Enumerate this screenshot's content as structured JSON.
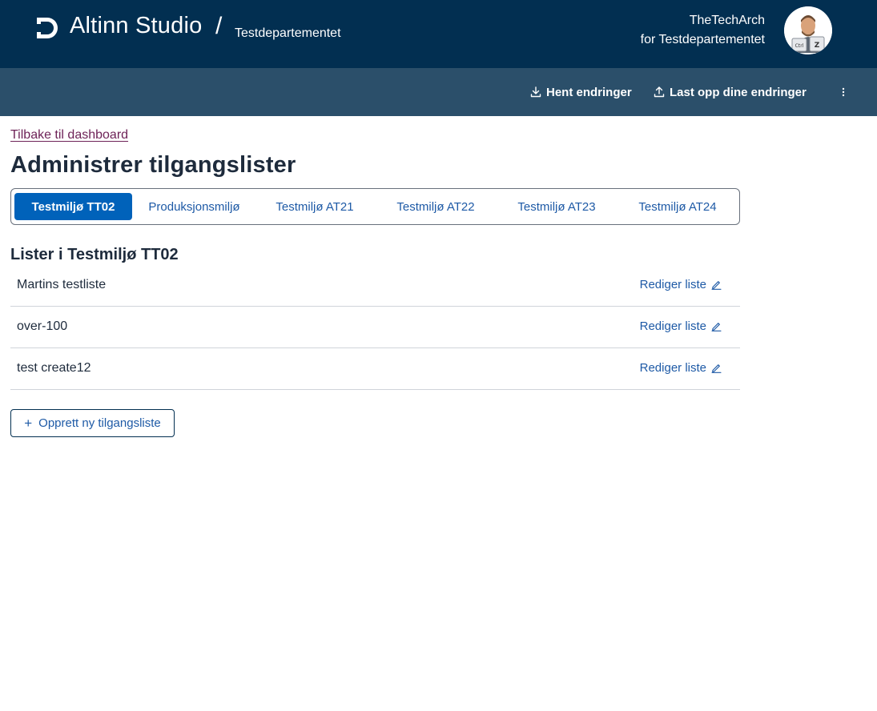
{
  "header": {
    "app_name": "Altinn Studio",
    "separator": "/",
    "org_name": "Testdepartementet",
    "user_name": "TheTechArch",
    "user_org": "for Testdepartementet",
    "logo_icon": "altinn-logo-icon",
    "avatar_icon": "user-avatar-icon",
    "background_color": "#022f51"
  },
  "subheader": {
    "fetch_label": "Hent endringer",
    "upload_label": "Last opp dine endringer",
    "more_icon": "kebab-menu-icon",
    "background_color": "#2b4f6a"
  },
  "back_link": "Tilbake til dashboard",
  "page_title": "Administrer tilgangslister",
  "tabs": [
    {
      "label": "Testmiljø TT02",
      "active": true
    },
    {
      "label": "Produksjonsmiljø",
      "active": false
    },
    {
      "label": "Testmiljø AT21",
      "active": false
    },
    {
      "label": "Testmiljø AT22",
      "active": false
    },
    {
      "label": "Testmiljø AT23",
      "active": false
    },
    {
      "label": "Testmiljø AT24",
      "active": false
    }
  ],
  "section_title": "Lister i Testmiljø TT02",
  "lists": [
    {
      "name": "Martins testliste",
      "edit_label": "Rediger liste"
    },
    {
      "name": "over-100",
      "edit_label": "Rediger liste"
    },
    {
      "name": "test create12",
      "edit_label": "Rediger liste"
    }
  ],
  "create_button": "Opprett ny tilgangsliste",
  "colors": {
    "accent": "#0062ba",
    "link": "#1e5aa6",
    "back_link": "#6e2358"
  }
}
